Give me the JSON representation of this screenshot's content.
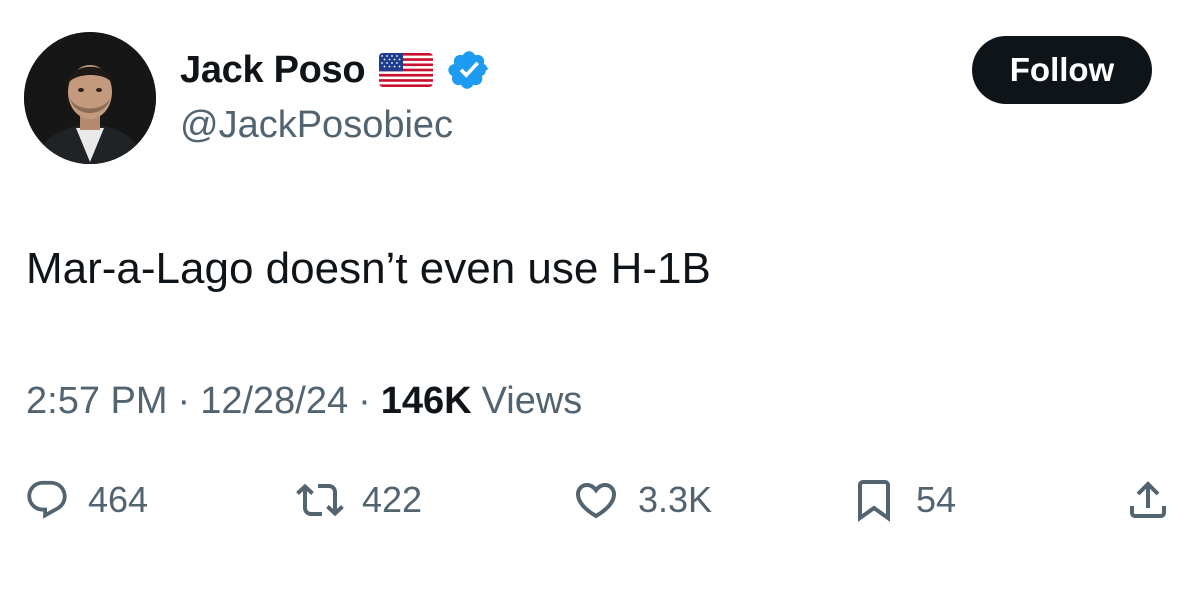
{
  "author": {
    "display_name": "Jack Poso",
    "handle": "@JackPosobiec",
    "flag_icon": "us-flag-icon",
    "verified_icon": "verified-badge-icon",
    "verified_color": "#1d9bf0"
  },
  "follow_button": {
    "label": "Follow"
  },
  "tweet": {
    "text": "Mar-a-Lago doesn’t even use H-1B"
  },
  "meta": {
    "time": "2:57 PM",
    "separator": "·",
    "date": "12/28/24",
    "views_count": "146K",
    "views_label": "Views"
  },
  "actions": {
    "reply": {
      "icon": "reply-icon",
      "count": "464"
    },
    "retweet": {
      "icon": "retweet-icon",
      "count": "422"
    },
    "like": {
      "icon": "heart-icon",
      "count": "3.3K"
    },
    "bookmark": {
      "icon": "bookmark-icon",
      "count": "54"
    },
    "share": {
      "icon": "share-icon"
    }
  },
  "colors": {
    "text_primary": "#0f1419",
    "text_secondary": "#536471",
    "button_bg": "#0f1419"
  }
}
